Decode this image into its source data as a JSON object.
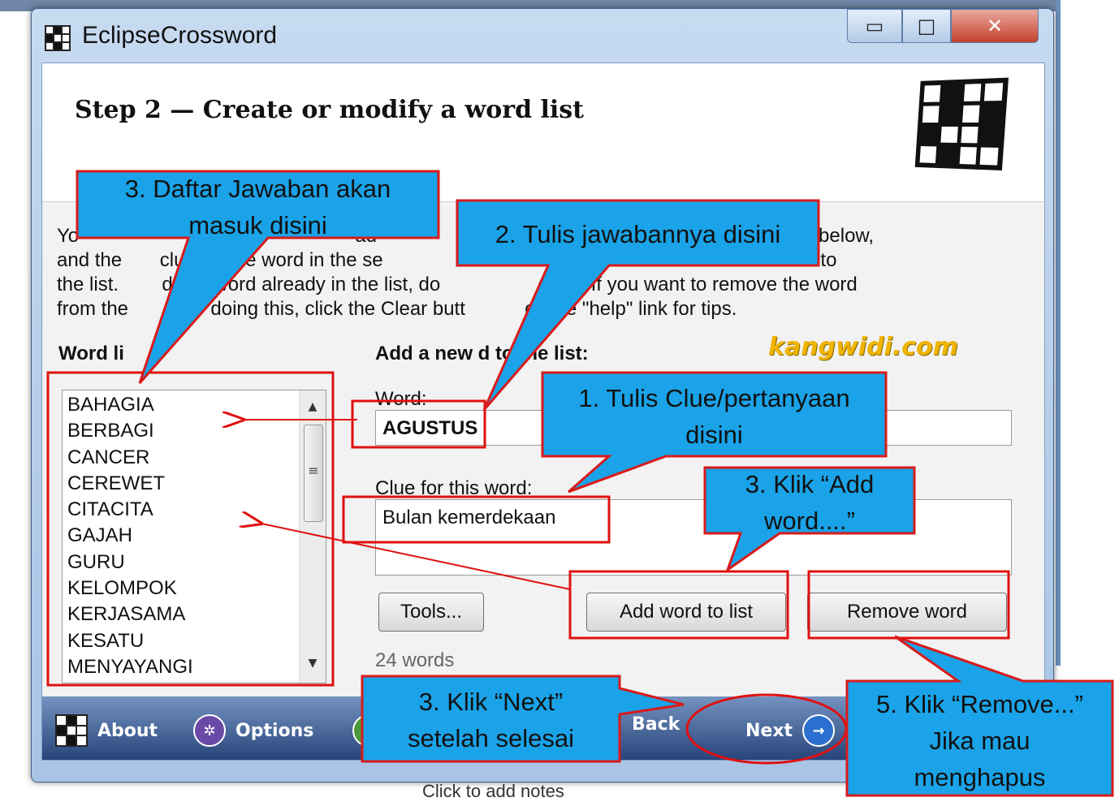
{
  "background": {
    "bottom_note": "Click to add notes"
  },
  "window": {
    "title": "EclipseCrossword",
    "controls": {
      "minimize": "▭",
      "maximize": "□",
      "close": "✕"
    }
  },
  "header": {
    "step_title": "Step 2 — Create or modify a word list"
  },
  "intro_text": "Yo                                                   ad                                                              the first box below,\nand the       clue for the word in the se                                                       to add the word to\nthe list.        dify a word already in the list, do                  on it.  If you want to remove the word\nfrom the         fter doing this, click the Clear butt           ck the \"help\" link for tips.",
  "word_list": {
    "label": "Word li",
    "items": [
      "BAHAGIA",
      "BERBAGI",
      "CANCER",
      "CEREWET",
      "CITACITA",
      "GAJAH",
      "GURU",
      "KELOMPOK",
      "KERJASAMA",
      "KESATU",
      "MENYAYANGI"
    ],
    "scroll_up": "▲",
    "scroll_down": "▼",
    "scroll_grip": "≡"
  },
  "add_word": {
    "heading": "Add a new         d to the list:",
    "word_label": "Word:",
    "word_value": "AGUSTUS",
    "clue_label": "Clue for this word:",
    "clue_value": "Bulan kemerdekaan"
  },
  "buttons": {
    "tools": "Tools...",
    "add_word": "Add word to list",
    "remove_word": "Remove word"
  },
  "word_count": "24 words",
  "footer": {
    "about": "About",
    "options": "Options",
    "back": "Back",
    "next": "Next",
    "next_icon": "→",
    "options_icon": "✲"
  },
  "watermark": "kangwidi.com",
  "callouts": {
    "daftar": [
      "3. Daftar Jawaban akan",
      "masuk disini"
    ],
    "tulis_jawaban": "2. Tulis jawabannya disini",
    "tulis_clue": [
      "1. Tulis Clue/pertanyaan",
      "disini"
    ],
    "klik_add": [
      "3. Klik “Add",
      "word....”"
    ],
    "klik_next": [
      "3. Klik “Next”",
      "setelah selesai"
    ],
    "klik_remove": [
      "5. Klik “Remove...”",
      "Jika mau",
      "menghapus"
    ]
  },
  "colors": {
    "callout_fill": "#1aa3e8",
    "callout_border": "#d81b1b",
    "highlight": "#e01010",
    "footer_top": "#7593c0",
    "footer_bottom": "#27457a",
    "watermark": "#f0b400"
  }
}
